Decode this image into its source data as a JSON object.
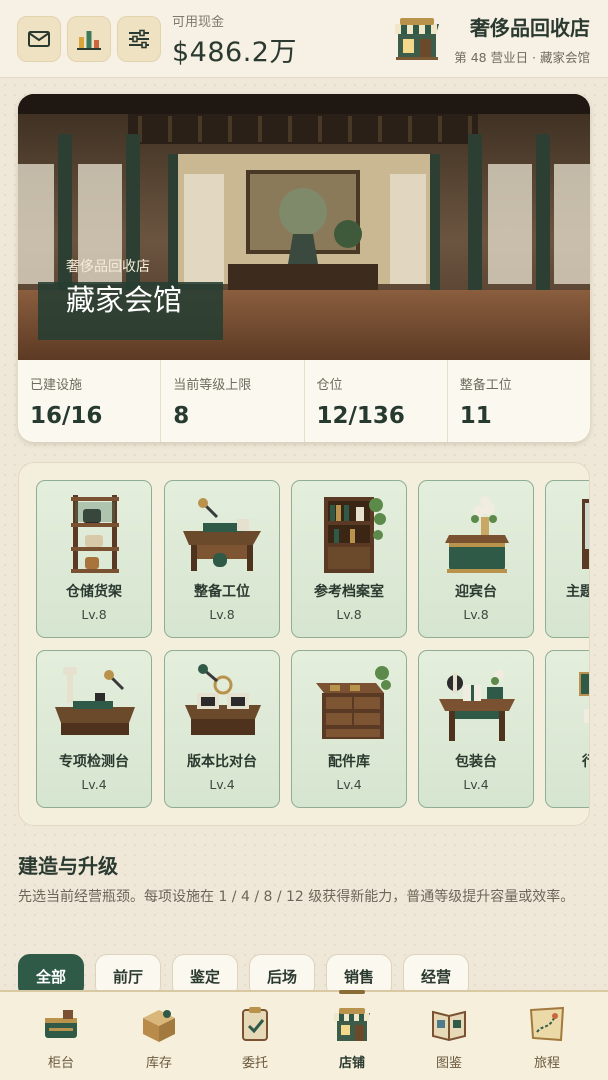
{
  "header": {
    "cash_label": "可用现金",
    "cash_value": "$486.2万",
    "store_title": "奢侈品回收店",
    "store_sub": "第 48 营业日 · 藏家会馆",
    "buttons": [
      {
        "icon": "mail-icon"
      },
      {
        "icon": "bar-chart-icon"
      },
      {
        "icon": "sliders-icon"
      }
    ]
  },
  "hero": {
    "overline": "奢侈品回收店",
    "name": "藏家会馆"
  },
  "stats": [
    {
      "label": "已建设施",
      "value": "16/16"
    },
    {
      "label": "当前等级上限",
      "value": "8"
    },
    {
      "label": "仓位",
      "value": "12/136"
    },
    {
      "label": "整备工位",
      "value": "11"
    }
  ],
  "facilities": [
    {
      "name": "仓储货架",
      "level": "Lv.8",
      "icon": "storage-shelf-icon"
    },
    {
      "name": "整备工位",
      "level": "Lv.8",
      "icon": "workbench-icon"
    },
    {
      "name": "参考档案室",
      "level": "Lv.8",
      "icon": "archive-bookcase-icon"
    },
    {
      "name": "迎宾台",
      "level": "Lv.8",
      "icon": "reception-desk-icon"
    },
    {
      "name": "主题",
      "level": "",
      "icon": "display-case-icon"
    },
    {
      "name": "专项检测台",
      "level": "Lv.4",
      "icon": "microscope-desk-icon"
    },
    {
      "name": "版本比对台",
      "level": "Lv.4",
      "icon": "comparison-desk-icon"
    },
    {
      "name": "配件库",
      "level": "Lv.4",
      "icon": "parts-cabinet-icon"
    },
    {
      "name": "包装台",
      "level": "Lv.4",
      "icon": "packing-table-icon"
    },
    {
      "name": "行",
      "level": "",
      "icon": "easel-icon"
    }
  ],
  "build": {
    "title": "建造与升级",
    "description": "先选当前经营瓶颈。每项设施在 1 / 4 / 8 / 12 级获得新能力，普通等级提升容量或效率。"
  },
  "filters": [
    "全部",
    "前厅",
    "鉴定",
    "后场",
    "销售",
    "经营"
  ],
  "active_filter": "全部",
  "nav": [
    {
      "label": "柜台",
      "icon": "counter-icon"
    },
    {
      "label": "库存",
      "icon": "inventory-box-icon"
    },
    {
      "label": "委托",
      "icon": "consignment-clipboard-icon"
    },
    {
      "label": "店铺",
      "icon": "shop-storefront-icon"
    },
    {
      "label": "图鉴",
      "icon": "catalog-book-icon"
    },
    {
      "label": "旅程",
      "icon": "journey-map-icon"
    }
  ],
  "active_nav": "店铺",
  "colors": {
    "accent_green": "#2e5a47",
    "background": "#efe8d8",
    "tile_green": "#d6e5d0",
    "gold": "#8a6b34"
  }
}
